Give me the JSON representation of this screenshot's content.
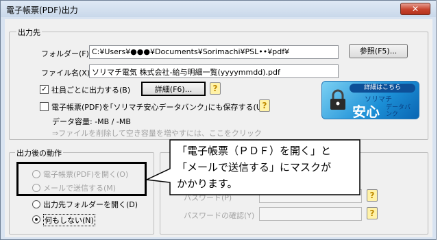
{
  "window": {
    "title": "電子帳票(PDF)出力",
    "close_glyph": "✕"
  },
  "output_group": {
    "label": "出力先",
    "folder": {
      "label": "フォルダー(F)",
      "value": "C:¥Users¥●●●¥Documents¥Sorimachi¥PSL••¥pdf¥",
      "browse_label": "参照(F5)..."
    },
    "filename": {
      "label": "ファイル名(X)",
      "value": "ソリマチ電気 株式会社-給与明細一覧(yyyymmdd).pdf"
    },
    "per_employee": {
      "label": "社員ごとに出力する(B)",
      "checked": true,
      "detail_label": "詳細(F6)..."
    },
    "save_bank": {
      "label": "電子帳票(PDF)を｢ソリマチ安心データバンク｣にも保存する(U)",
      "checked": false
    },
    "capacity_text": "データ容量: -MB / -MB",
    "hint_text": "⇒ファイルを削除して空き容量を増やすには、ここをクリック"
  },
  "banner": {
    "top_text": "詳細はこちら",
    "brand_text": "ソリマチ",
    "main_text": "安心",
    "side_text": "データバンク"
  },
  "after_group": {
    "label": "出力後の動作",
    "options": [
      {
        "label": "電子帳票(PDF)を開く(O)",
        "disabled": true,
        "checked": false
      },
      {
        "label": "メールで送信する(M)",
        "disabled": true,
        "checked": false
      },
      {
        "label": "出力先フォルダーを開く(D)",
        "disabled": false,
        "checked": false
      },
      {
        "label": "何もしない(N)",
        "disabled": false,
        "checked": true
      }
    ]
  },
  "password_area": {
    "pw_label_partial": "パスワード(P)",
    "pw_confirm_label": "パスワードの確認(Y)"
  },
  "callout": {
    "line1": "「電子帳票（ＰＤＦ）を開く」と",
    "line2": "「メールで送信する」にマスクが",
    "line3": "かかります。"
  },
  "help_glyph": "?"
}
